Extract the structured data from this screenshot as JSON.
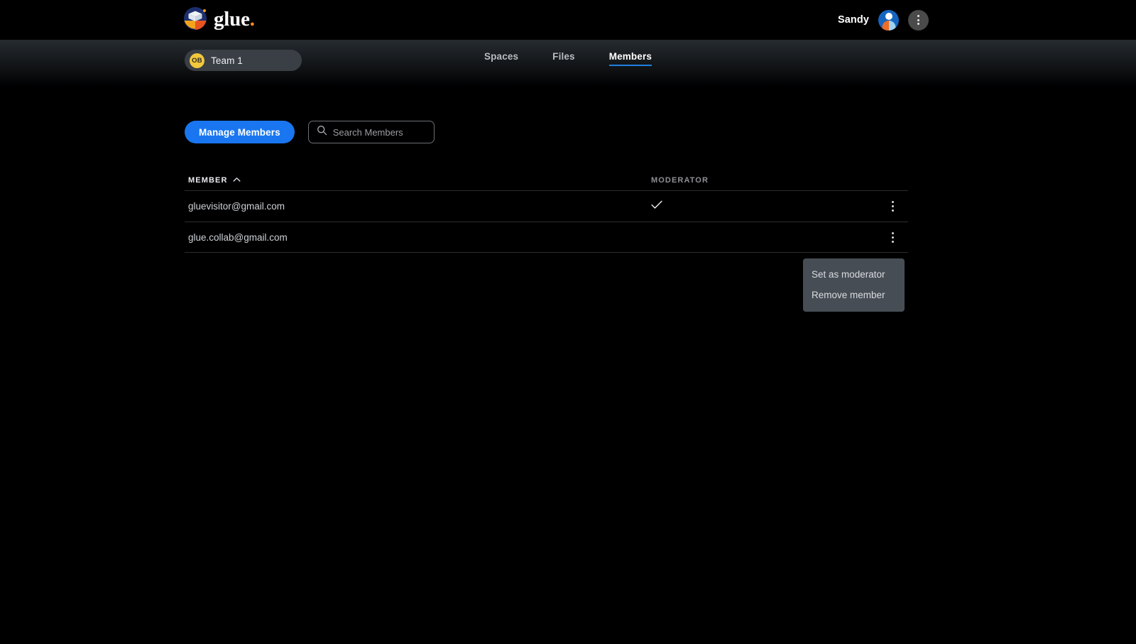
{
  "brand": {
    "wordmark": "glue",
    "dot": ".",
    "logo_icon": "glue-cube-logo",
    "accent_orange": "#f08a20"
  },
  "topbar": {
    "user_name": "Sandy",
    "avatar_icon": "user-avatar-icon",
    "overflow_icon": "kebab-menu-icon"
  },
  "subbar": {
    "team": {
      "badge": "OB",
      "label": "Team 1"
    },
    "nav": [
      {
        "label": "Spaces",
        "active": false
      },
      {
        "label": "Files",
        "active": false
      },
      {
        "label": "Members",
        "active": true
      }
    ],
    "active_underline_color": "#1f7fe0"
  },
  "toolbar": {
    "manage_members_label": "Manage Members",
    "manage_members_color": "#1976f0",
    "search": {
      "icon": "search-icon",
      "placeholder": "Search Members",
      "value": ""
    }
  },
  "table": {
    "columns": [
      {
        "label": "MEMBER",
        "sort": "asc",
        "sort_icon": "chevron-up-icon"
      },
      {
        "label": "MODERATOR",
        "sort": null
      }
    ],
    "rows": [
      {
        "member": "gluevisitor@gmail.com",
        "moderator": true,
        "moderator_icon": "check-icon",
        "row_menu_icon": "kebab-menu-icon"
      },
      {
        "member": "glue.collab@gmail.com",
        "moderator": false,
        "moderator_icon": "",
        "row_menu_icon": "kebab-menu-icon"
      }
    ]
  },
  "context_menu": {
    "visible": true,
    "items": [
      {
        "label": "Set as moderator"
      },
      {
        "label": "Remove member"
      }
    ]
  }
}
